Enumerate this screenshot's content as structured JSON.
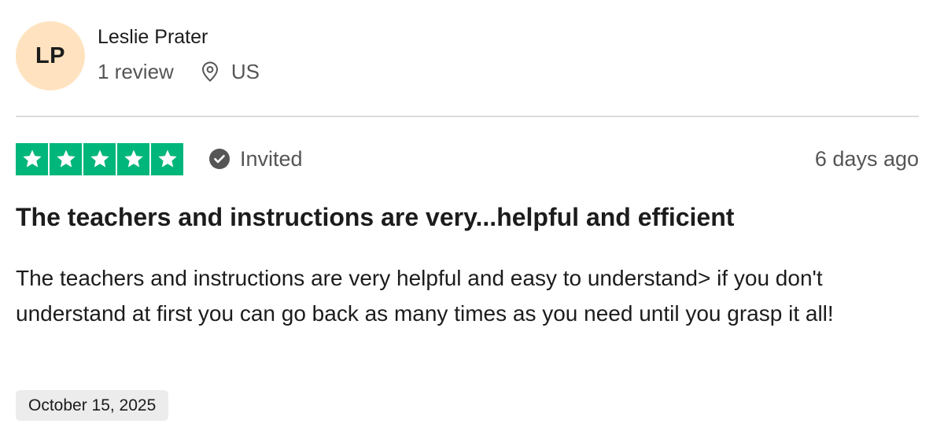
{
  "reviewer": {
    "initials": "LP",
    "name": "Leslie Prater",
    "review_count": "1 review",
    "location": "US",
    "avatar_color": "#ffe3c0"
  },
  "rating": {
    "stars": 5,
    "max_stars": 5,
    "star_color": "#00b67a",
    "badge_label": "Invited",
    "time_ago": "6 days ago"
  },
  "review": {
    "title": "The teachers and instructions are very...helpful and efficient",
    "body": "The teachers and instructions are very helpful and easy to understand> if you don't understand at first you can go back as many times as you need until you grasp it all!",
    "date": "October 15, 2025"
  },
  "icons": {
    "location": "location-pin-icon",
    "invited": "check-circle-icon",
    "star": "star-icon"
  }
}
